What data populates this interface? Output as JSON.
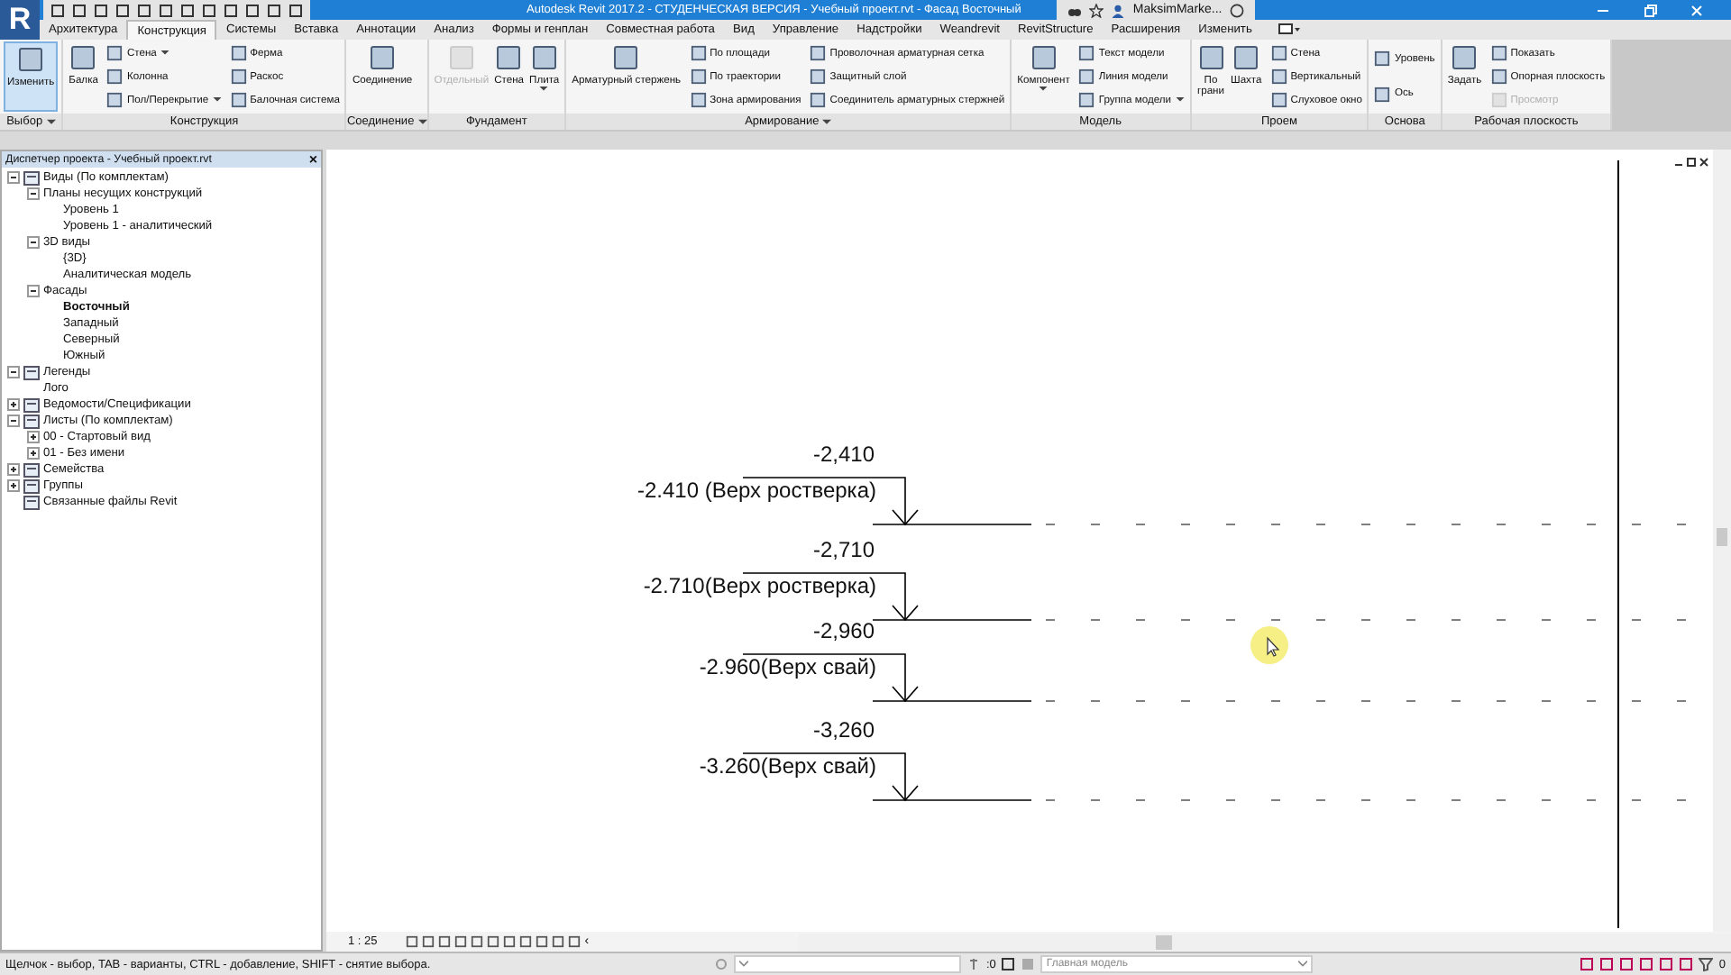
{
  "window": {
    "logo": "R",
    "title": "Autodesk Revit 2017.2 - СТУДЕНЧЕСКАЯ ВЕРСИЯ -   Учебный проект.rvt - Фасад Восточный",
    "user": "MaksimMarke..."
  },
  "tabs": [
    {
      "label": "Архитектура",
      "selected": false
    },
    {
      "label": "Конструкция",
      "selected": true
    },
    {
      "label": "Системы",
      "selected": false
    },
    {
      "label": "Вставка",
      "selected": false
    },
    {
      "label": "Аннотации",
      "selected": false
    },
    {
      "label": "Анализ",
      "selected": false
    },
    {
      "label": "Формы и генплан",
      "selected": false
    },
    {
      "label": "Совместная работа",
      "selected": false
    },
    {
      "label": "Вид",
      "selected": false
    },
    {
      "label": "Управление",
      "selected": false
    },
    {
      "label": "Надстройки",
      "selected": false
    },
    {
      "label": "Weandrevit",
      "selected": false
    },
    {
      "label": "RevitStructure",
      "selected": false
    },
    {
      "label": "Расширения",
      "selected": false
    },
    {
      "label": "Изменить",
      "selected": false
    }
  ],
  "ribbon": {
    "panels": [
      {
        "title": "Выбор",
        "menu": true,
        "groups": [
          {
            "kind": "large",
            "tools": [
              {
                "label": "Изменить",
                "selected": true
              }
            ]
          }
        ]
      },
      {
        "title": "Конструкция",
        "menu": false,
        "groups": [
          {
            "kind": "large",
            "tools": [
              {
                "label": "Балка"
              }
            ]
          },
          {
            "kind": "small",
            "tools": [
              {
                "label": "Стена",
                "dropdown": true
              },
              {
                "label": "Колонна",
                "dropdown": false
              },
              {
                "label": "Пол/Перекрытие",
                "dropdown": true
              }
            ]
          },
          {
            "kind": "small",
            "tools": [
              {
                "label": "Ферма"
              },
              {
                "label": "Раскос"
              },
              {
                "label": "Балочная система"
              }
            ]
          }
        ]
      },
      {
        "title": "Соединение",
        "menu": true,
        "groups": [
          {
            "kind": "large",
            "tools": [
              {
                "label": "Соединение"
              }
            ]
          }
        ]
      },
      {
        "title": "Фундамент",
        "menu": false,
        "groups": [
          {
            "kind": "large",
            "tools": [
              {
                "label": "Отдельный",
                "disabled": true,
                "dropdown": false
              },
              {
                "label": "Стена",
                "disabled": false,
                "dropdown": false
              },
              {
                "label": "Плита",
                "disabled": false,
                "dropdown": true
              }
            ]
          }
        ]
      },
      {
        "title": "Армирование",
        "menu": true,
        "groups": [
          {
            "kind": "large",
            "tools": [
              {
                "label": "Арматурный стержень"
              }
            ]
          },
          {
            "kind": "small",
            "tools": [
              {
                "label": "По площади"
              },
              {
                "label": "По траектории"
              },
              {
                "label": "Зона армирования"
              }
            ]
          },
          {
            "kind": "small",
            "tools": [
              {
                "label": "Проволочная арматурная сетка"
              },
              {
                "label": "Защитный слой"
              },
              {
                "label": "Соединитель арматурных стержней"
              }
            ]
          }
        ]
      },
      {
        "title": "Модель",
        "menu": false,
        "groups": [
          {
            "kind": "large",
            "tools": [
              {
                "label": "Компонент",
                "dropdown": true
              }
            ]
          },
          {
            "kind": "small",
            "tools": [
              {
                "label": "Текст модели",
                "dropdown": false
              },
              {
                "label": "Линия модели",
                "dropdown": false
              },
              {
                "label": "Группа модели",
                "dropdown": true
              }
            ]
          }
        ]
      },
      {
        "title": "Проем",
        "menu": false,
        "groups": [
          {
            "kind": "large",
            "tools": [
              {
                "label": "По\nграни"
              },
              {
                "label": "Шахта"
              }
            ]
          },
          {
            "kind": "small",
            "tools": [
              {
                "label": "Стена"
              },
              {
                "label": "Вертикальный"
              },
              {
                "label": "Слуховое окно"
              }
            ]
          }
        ]
      },
      {
        "title": "Основа",
        "menu": false,
        "groups": [
          {
            "kind": "small",
            "tools": [
              {
                "label": "Уровень"
              },
              {
                "label": "Ось"
              }
            ]
          }
        ]
      },
      {
        "title": "Рабочая плоскость",
        "menu": false,
        "groups": [
          {
            "kind": "large",
            "tools": [
              {
                "label": "Задать"
              }
            ]
          },
          {
            "kind": "small",
            "tools": [
              {
                "label": "Показать",
                "disabled": false
              },
              {
                "label": "Опорная плоскость",
                "disabled": false
              },
              {
                "label": "Просмотр",
                "disabled": true
              }
            ]
          }
        ]
      }
    ]
  },
  "browser": {
    "title": "Диспетчер проекта - Учебный проект.rvt",
    "close": "×",
    "tree": [
      {
        "label": "Виды (По комплектам)",
        "expanded": true,
        "children": [
          {
            "label": "Планы несущих конструкций",
            "expanded": true,
            "children": [
              {
                "label": "Уровень 1",
                "selected": false
              },
              {
                "label": "Уровень 1 - аналитический",
                "selected": false
              }
            ]
          },
          {
            "label": "3D виды",
            "expanded": true,
            "children": [
              {
                "label": "{3D}",
                "selected": false
              },
              {
                "label": "Аналитическая модель",
                "selected": false
              }
            ]
          },
          {
            "label": "Фасады",
            "expanded": true,
            "children": [
              {
                "label": "Восточный",
                "selected": true
              },
              {
                "label": "Западный",
                "selected": false
              },
              {
                "label": "Северный",
                "selected": false
              },
              {
                "label": "Южный",
                "selected": false
              }
            ]
          }
        ]
      },
      {
        "label": "Легенды",
        "expanded": true,
        "children": [
          {
            "label": "Лого",
            "selected": false
          }
        ]
      },
      {
        "label": "Ведомости/Спецификации",
        "expanded": false
      },
      {
        "label": "Листы (По комплектам)",
        "expanded": true,
        "children": [
          {
            "label": "00 - Стартовый вид",
            "expanded": false
          },
          {
            "label": "01 - Без имени",
            "expanded": false
          }
        ]
      },
      {
        "label": "Семейства",
        "expanded": false
      },
      {
        "label": "Группы",
        "expanded": false
      },
      {
        "label": "Связанные файлы Revit"
      }
    ]
  },
  "canvas": {
    "levels": [
      {
        "elevation": "-2,410",
        "label": "-2.410 (Верх ростверка)"
      },
      {
        "elevation": "-2,710",
        "label": "-2.710(Верх ростверка)"
      },
      {
        "elevation": "-2,960",
        "label": "-2.960(Верх свай)"
      },
      {
        "elevation": "-3,260",
        "label": "-3.260(Верх свай)"
      }
    ]
  },
  "view_bar": {
    "scale": "1 : 25",
    "more": "‹"
  },
  "status_bar": {
    "hint": "Щелчок - выбор, TAB - варианты, CTRL - добавление, SHIFT - снятие выбора.",
    "count": ":0",
    "workset": "Главная модель",
    "filter_count": "0"
  }
}
